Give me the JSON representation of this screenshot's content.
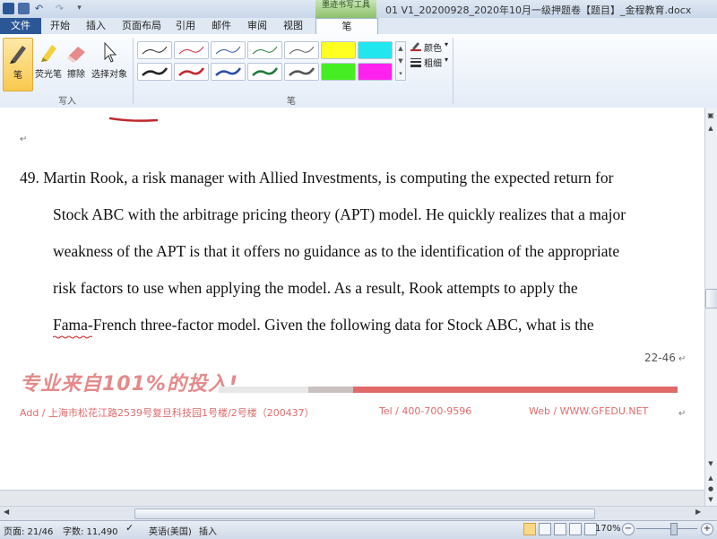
{
  "window": {
    "doc_title": "01 V1_20200928_2020年10月一级押题卷【题目】_金程教育.docx",
    "contextual_tab_label": "墨迹书写工具"
  },
  "tabs": [
    "文件",
    "开始",
    "插入",
    "页面布局",
    "引用",
    "邮件",
    "审阅",
    "视图",
    "笔"
  ],
  "ribbon": {
    "write_group": {
      "label": "写入",
      "tools": [
        "笔",
        "荧光笔",
        "擦除",
        "选择对象"
      ]
    },
    "pens_group": {
      "label": "笔",
      "color_label": "颜色",
      "weight_label": "粗细"
    }
  },
  "document": {
    "paragraph_mark": "↵",
    "lines": [
      "49.  Martin Rook, a risk manager with Allied Investments, is computing the expected return for",
      "Stock ABC with the arbitrage pricing theory (APT) model. He quickly realizes that a major",
      "weakness of the APT is that it offers no guidance as to the identification of the appropriate",
      "risk factors to use when applying the model. As a result, Rook attempts to apply the",
      "Fama-French three-factor model. Given the following data for Stock ABC, what is the"
    ],
    "page_number": "22-46",
    "footer": {
      "slogan": "专业来自101%的投入!",
      "address": "Add / 上海市松花江路2539号复旦科技园1号楼/2号楼（200437）",
      "tel": "Tel / 400-700-9596",
      "web": "Web / WWW.GFEDU.NET"
    }
  },
  "status": {
    "page": "页面: 21/46",
    "words": "字数: 11,490",
    "language": "英语(美国)",
    "mode": "插入",
    "zoom": "170%"
  },
  "colors": {
    "file_tab": "#2b5797",
    "accent_red": "#e06a6a",
    "active_pen_tool": "#f9c94d"
  }
}
